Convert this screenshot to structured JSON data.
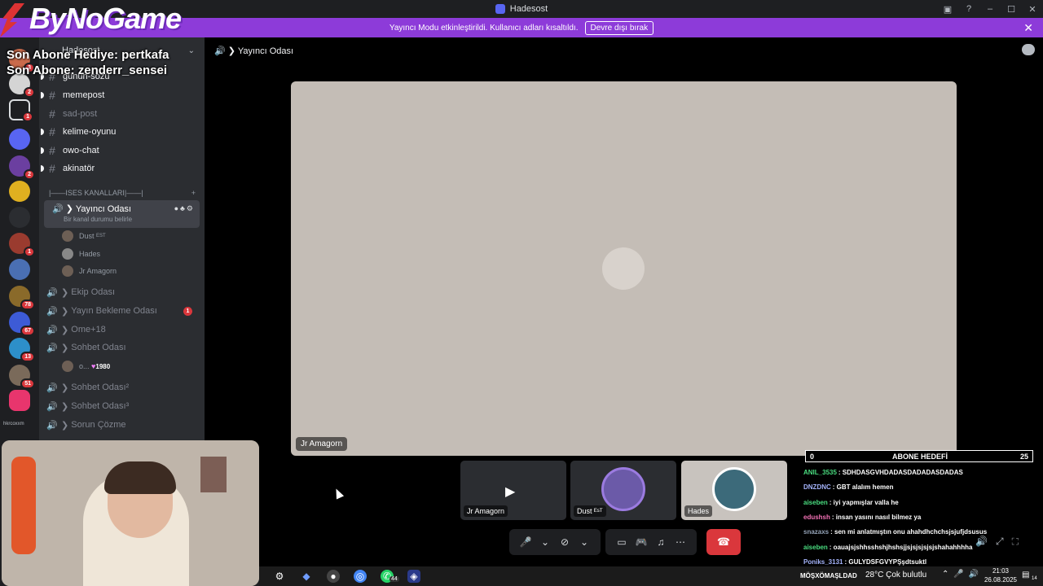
{
  "window": {
    "title": "Hadesost"
  },
  "banner": {
    "text": "Yayıncı Modu etkinleştirildi. Kullanıcı adları kısaltıldı.",
    "button_label": "Devre dışı bırak"
  },
  "overlay": {
    "brand": "ByNoGame",
    "last_gift": "Son Abone Hediye: pertkafa",
    "last_sub": "Son Abone: zenderr_sensei"
  },
  "server_list": {
    "badges": [
      "3",
      "2",
      "1",
      "2",
      "1",
      "78",
      "67",
      "13",
      "51"
    ],
    "bottom_label": "hkrcoxxm"
  },
  "sidebar": {
    "server_name": "Hadesost",
    "text_channels": [
      {
        "name": "günün-sözü",
        "unread": true
      },
      {
        "name": "memepost",
        "unread": true
      },
      {
        "name": "sad-post",
        "unread": false
      },
      {
        "name": "kelime-oyunu",
        "unread": true
      },
      {
        "name": "owo-chat",
        "unread": true
      },
      {
        "name": "akinatör",
        "unread": true
      }
    ],
    "category": "|——ISES KANALLARI|——|",
    "active_voice": {
      "name": "Yayıncı Odası",
      "status": "Bir kanal durumu belirle"
    },
    "members": [
      {
        "name": "Dust",
        "tag": "EST"
      },
      {
        "name": "Hades",
        "tag": ""
      },
      {
        "name": "Jr Amagorn",
        "tag": ""
      }
    ],
    "voice_channels": [
      {
        "name": "Ekip Odası",
        "badge": ""
      },
      {
        "name": "Yayın Bekleme Odası",
        "badge": "1"
      },
      {
        "name": "Ome+18",
        "badge": ""
      },
      {
        "name": "Sohbet Odası",
        "badge": ""
      }
    ],
    "sohbet_member": {
      "name": "o...",
      "tag": "1980"
    },
    "voice_channels_2": [
      {
        "name": "Sohbet Odası²"
      },
      {
        "name": "Sohbet Odası³"
      },
      {
        "name": "Sorun Çözme"
      }
    ]
  },
  "main": {
    "channel_title": "Yayıncı Odası",
    "stage_name": "Jr Amagorn",
    "tiles": [
      {
        "name": "Jr Amagorn"
      },
      {
        "name": "Dust ᴱˢᵀ"
      },
      {
        "name": "Hades"
      }
    ]
  },
  "sub_goal": {
    "current": "0",
    "label": "ABONE HEDEFİ",
    "target": "25"
  },
  "chat": [
    {
      "user": "ANIL_3535",
      "color": "#4ade80",
      "msg": ": SDHDASGVHDADASDADADASDADAS"
    },
    {
      "user": "DNZDNC",
      "color": "#a5b4fc",
      "msg": ": GBT alalım hemen"
    },
    {
      "user": "aiseben",
      "color": "#4ade80",
      "msg": ": iyi yapmışlar valla he"
    },
    {
      "user": "edushsh",
      "color": "#f472b6",
      "msg": ": insan yasını nasıl bilmez ya"
    },
    {
      "user": "snazaxs",
      "color": "#94a3b8",
      "msg": ": sen mi anlatmıştın onu ahahdhchchsjsjufjdsusus"
    },
    {
      "user": "aiseben",
      "color": "#4ade80",
      "msg": ": oauajsjshhsshshjhshsjjsjsjsjsjsjshahahhhha"
    },
    {
      "user": "Poniks_3131",
      "color": "#a5b4fc",
      "msg": ": GULYDSFGVYPŞşdtsuktl"
    }
  ],
  "taskbar": {
    "ticker": "MÖŞXÖMAŞLDAD",
    "weather": "28°C  Çok bulutlu",
    "time": "21:03",
    "date": "26.08.2025",
    "whatsapp_badge": "44",
    "notif_count": "14"
  }
}
